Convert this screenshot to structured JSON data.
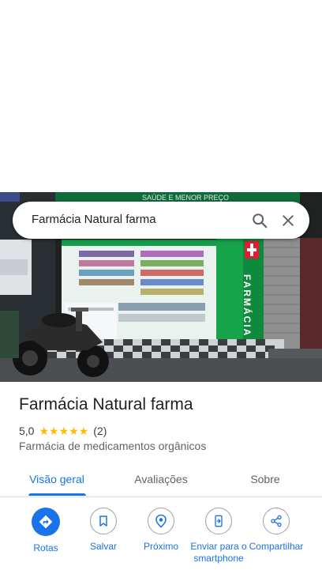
{
  "search": {
    "query": "Farmácia Natural farma"
  },
  "photo": {
    "banner_text": "SAÚDE E MENOR PREÇO",
    "sign_text": "FARMÁCIA"
  },
  "place": {
    "name": "Farmácia Natural farma",
    "rating": "5,0",
    "stars": [
      "★",
      "★",
      "★",
      "★",
      "★"
    ],
    "review_count": "(2)",
    "category": "Farmácia de medicamentos orgânicos"
  },
  "tabs": [
    {
      "label": "Visão geral",
      "active": true
    },
    {
      "label": "Avaliações",
      "active": false
    },
    {
      "label": "Sobre",
      "active": false
    }
  ],
  "actions": [
    {
      "label": "Rotas",
      "icon": "directions-icon"
    },
    {
      "label": "Salvar",
      "icon": "bookmark-icon"
    },
    {
      "label": "Próximo",
      "icon": "nearby-icon"
    },
    {
      "label": "Enviar para o smartphone",
      "icon": "send-to-phone-icon"
    },
    {
      "label": "Compartilhar",
      "icon": "share-icon"
    }
  ],
  "colors": {
    "accent": "#1a73e8",
    "star": "#fbbc04",
    "pharmacy_green": "#16a34a"
  }
}
